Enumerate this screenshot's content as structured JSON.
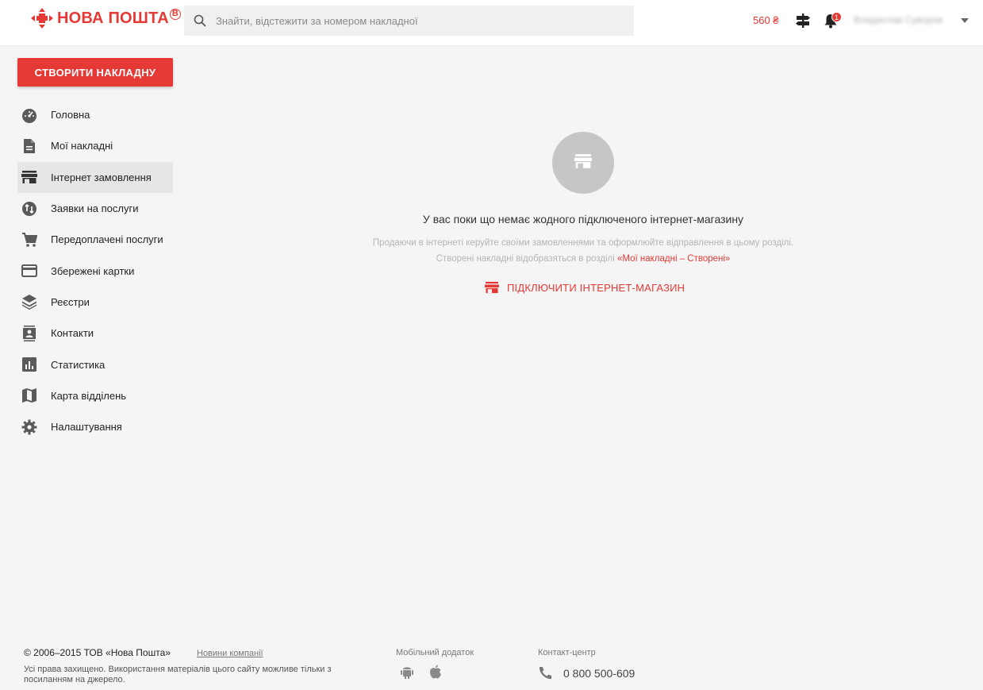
{
  "header": {
    "logo_text": "НОВА ПОШТА",
    "logo_mark": "B",
    "search_placeholder": "Знайти, відстежити за номером накладної",
    "balance": "560 ₴",
    "notification_count": "1",
    "user_name": "Владислав Суворов"
  },
  "sidebar": {
    "create_label": "Створити накладну",
    "items": [
      {
        "label": "Головна",
        "icon": "dashboard-icon"
      },
      {
        "label": "Мої накладні",
        "icon": "document-icon"
      },
      {
        "label": "Інтернет замовлення",
        "icon": "store-icon",
        "active": true
      },
      {
        "label": "Заявки на послуги",
        "icon": "service-request-icon"
      },
      {
        "label": "Передоплачені послуги",
        "icon": "cart-icon"
      },
      {
        "label": "Збережені картки",
        "icon": "credit-card-icon"
      },
      {
        "label": "Реєстри",
        "icon": "layers-icon"
      },
      {
        "label": "Контакти",
        "icon": "contacts-icon"
      },
      {
        "label": "Статистика",
        "icon": "bar-chart-icon"
      },
      {
        "label": "Карта відділень",
        "icon": "map-icon"
      },
      {
        "label": "Налаштування",
        "icon": "gear-icon"
      }
    ]
  },
  "empty_state": {
    "icon": "store-icon",
    "title": "У вас поки що немає жодного підключеного інтернет-магазину",
    "desc_line1": "Продаючи в інтернеті керуйте своїми замовленнями та оформлюйте відправлення в цьому розділі.",
    "desc_line2_prefix": "Створені накладні відобразяться в розділі ",
    "desc_line2_link": "«Мої накладні – Створені»",
    "connect_label": "Підключити інтернет-магазин"
  },
  "footer": {
    "copyright": "© 2006–2015 ТОВ «Нова Пошта»",
    "news_link": "Новини компанії",
    "rights": "Усі права захищено. Використання матеріалів цього сайту можливе тільки з посиланням на джерело.",
    "mobile_label": "Мобільний додаток",
    "contact_label": "Контакт-центр",
    "phone": "0 800 500-609"
  },
  "colors": {
    "brand_red": "#e53935",
    "background": "#f5f5f5",
    "active_item": "#e6e6e6"
  }
}
